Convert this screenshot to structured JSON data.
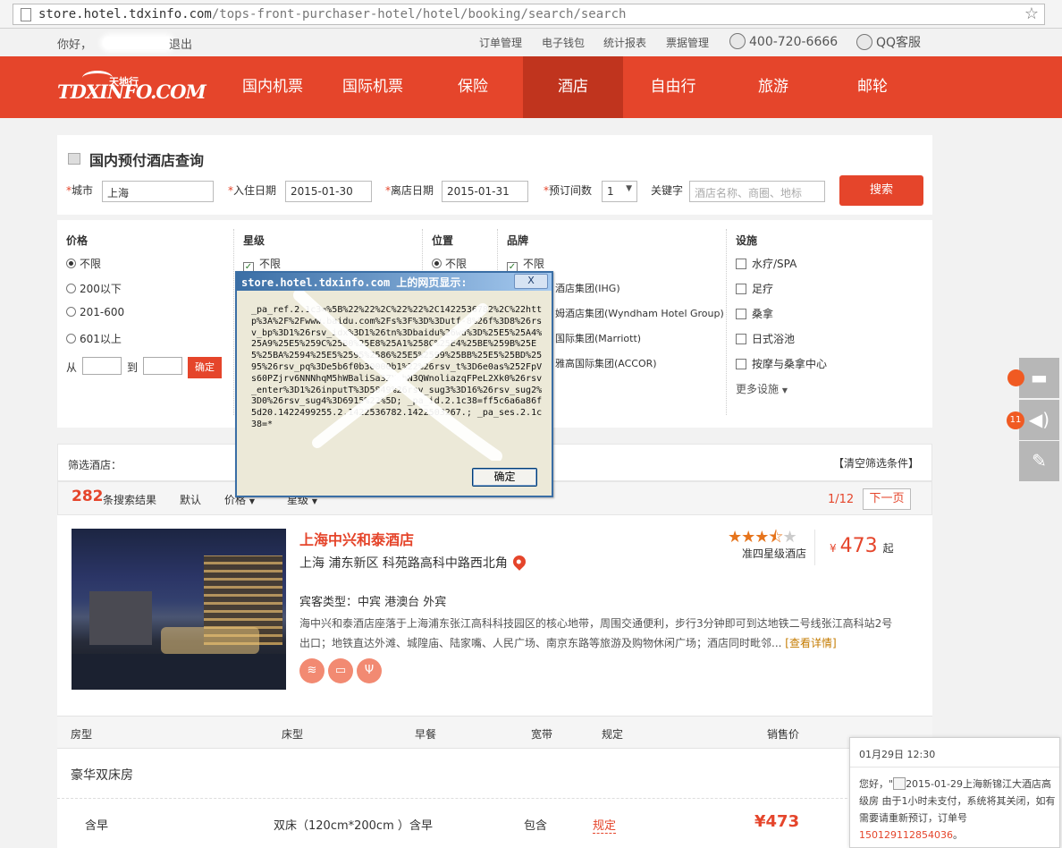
{
  "browser": {
    "url_domain": "store.hotel.tdxinfo.com",
    "url_path": "/tops-front-purchaser-hotel/hotel/booking/search/search"
  },
  "userbar": {
    "greeting": "你好，",
    "logout": "退出",
    "links": [
      "订单管理",
      "电子钱包",
      "统计报表",
      "票据管理"
    ],
    "phone": "400-720-6666",
    "qq": "QQ客服"
  },
  "nav": {
    "logo_main": "TDXINFO.COM",
    "logo_cn": "天地行",
    "items": [
      "国内机票",
      "国际机票",
      "保险",
      "酒店",
      "自由行",
      "旅游",
      "邮轮"
    ],
    "active": "酒店"
  },
  "search": {
    "title": "国内预付酒店查询",
    "city_label": "城市",
    "city_value": "上海",
    "checkin_label": "入住日期",
    "checkin_value": "2015-01-30",
    "checkout_label": "离店日期",
    "checkout_value": "2015-01-31",
    "rooms_label": "预订间数",
    "rooms_value": "1",
    "keyword_label": "关键字",
    "keyword_placeholder": "酒店名称、商圈、地标",
    "search_button": "搜索"
  },
  "filters": {
    "price": {
      "title": "价格",
      "options": [
        "不限",
        "200以下",
        "201-600",
        "601以上"
      ],
      "from": "从",
      "to": "到",
      "ok": "确定"
    },
    "star": {
      "title": "星级",
      "options": [
        "不限"
      ]
    },
    "location": {
      "title": "位置",
      "options": [
        "不限"
      ]
    },
    "brand": {
      "title": "品牌",
      "options": [
        "不限",
        "酒店集团(IHG)",
        "姆酒店集团(Wyndham Hotel Group)",
        "国际集团(Marriott)",
        "雅高国际集团(ACCOR)"
      ]
    },
    "facility": {
      "title": "设施",
      "options": [
        "水疗/SPA",
        "足疗",
        "桑拿",
        "日式浴池",
        "按摩与桑拿中心"
      ],
      "more": "更多设施"
    }
  },
  "screening": {
    "label": "筛选酒店：",
    "clear": "【清空筛选条件】"
  },
  "results": {
    "count": "282",
    "count_label": "条搜索结果",
    "sorts": [
      "默认",
      "价格",
      "星级"
    ],
    "page": "1/12",
    "next": "下一页"
  },
  "hotel": {
    "name": "上海中兴和泰酒店",
    "address": "上海  浦东新区  科苑路高科中路西北角",
    "guest_type": "宾客类型：中宾  港澳台  外宾",
    "description": "海中兴和泰酒店座落于上海浦东张江高科科技园区的核心地带，周围交通便利，步行3分钟即可到达地铁二号线张江高科站2号出口；地铁直达外滩、城隍庙、陆家嘴、人民广场、南京东路等旅游及购物休闲广场；酒店同时毗邻...",
    "more": "[查看详情]",
    "amenities": [
      "wifi-icon",
      "shuttle-icon",
      "restaurant-icon"
    ],
    "stars": 3.5,
    "star_label": "准四星级酒店",
    "price_currency": "¥",
    "price": "473",
    "price_suffix": "起"
  },
  "room_table": {
    "headers": [
      "房型",
      "床型",
      "早餐",
      "宽带",
      "规定",
      "销售价"
    ],
    "room_type": "豪华双床房",
    "row": {
      "breakfast_name": "含早",
      "bed": "双床（120cm*200cm ）",
      "breakfast": "含早",
      "broadband": "包含",
      "rule": "规定",
      "price": "¥473"
    }
  },
  "side": {
    "badge1": "",
    "badge2": "11"
  },
  "notification": {
    "time": "01月29日  12:30",
    "text_prefix": "您好，\"",
    "order_title": "2015-01-29上海新锦江大酒店高级房",
    "text_mid": "由于1小时未支付，系统将其关闭，如有需要请重新预订，订单号",
    "order_no": "150129112854036",
    "text_end": "。"
  },
  "dialog": {
    "title": "store.hotel.tdxinfo.com 上的网页显示:",
    "message": "_pa_ref.2.1c3=%5B%22%22%2C%22%22%2C1422536782%2C%22http%3A%2F%2Fwww.baidu.com%2Fs%3F%3D%3Dutf-8%26f%3D8%26rsv_bp%3D1%26rsv_idx%3D1%26tn%3Dbaidu%26wd%3D%25E5%25A4%25A9%25E5%259C%25B0%25E8%25A1%258C%25E4%25BE%259B%25E5%25BA%2594%25E5%2595%2586%25E5%2599%25BB%25E5%25BD%2595%26rsv_pq%3De5b6f0b30000b1%22%26rsv_t%3D6e0as%252FpVs60PZjrv6NNNhqM5hWBaliSa3ZXqhN3QWnoliazqFPeL2Xk0%26rsv_enter%3D1%26inputT%3D5849%26rsv_sug3%3D16%26rsv_sug2%3D0%26rsv_sug4%3D6915%22%5D; _pa_id.2.1c38=ff5c6a6a86f5d20.1422499255.2.1422536782.1422503267.; _pa_ses.2.1c38=*",
    "ok": "确定",
    "close": "X"
  }
}
